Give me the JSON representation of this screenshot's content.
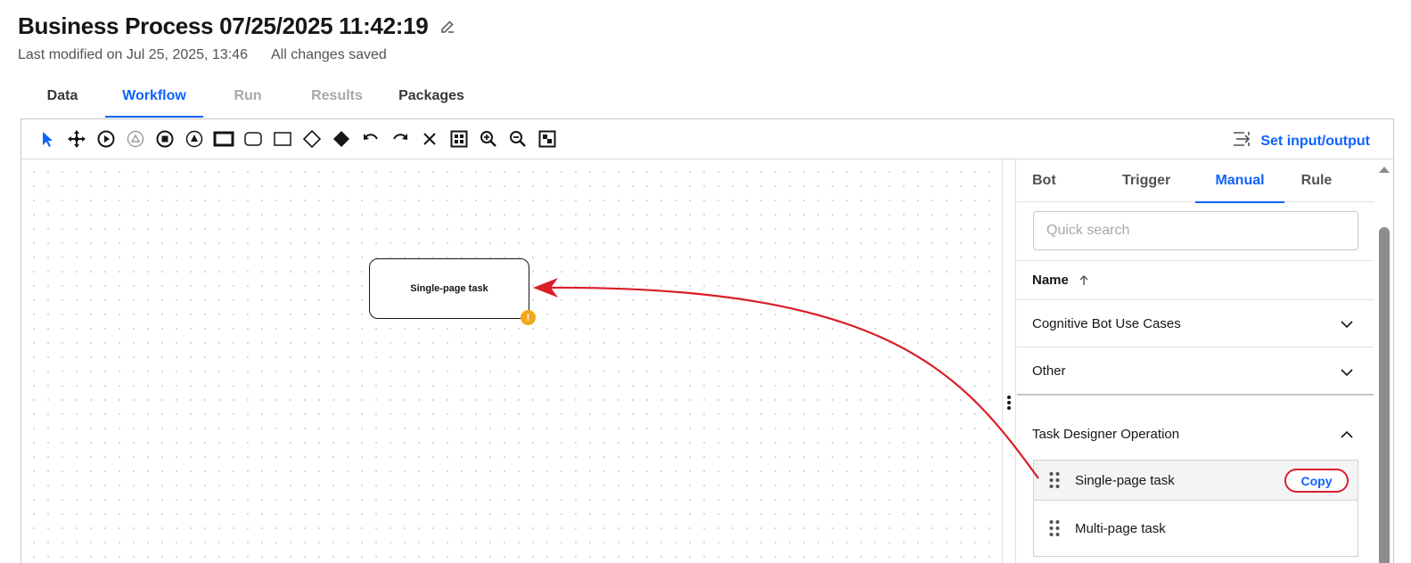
{
  "header": {
    "title": "Business Process 07/25/2025 11:42:19",
    "last_modified": "Last modified on Jul 25, 2025, 13:46",
    "save_status": "All changes saved"
  },
  "tabs": [
    {
      "label": "Data",
      "state": "default"
    },
    {
      "label": "Workflow",
      "state": "active"
    },
    {
      "label": "Run",
      "state": "disabled"
    },
    {
      "label": "Results",
      "state": "disabled"
    },
    {
      "label": "Packages",
      "state": "default"
    }
  ],
  "toolbar": {
    "tools": [
      "pointer-icon",
      "move-icon",
      "start-event-icon",
      "signal-event-icon",
      "end-event-icon",
      "escalation-event-icon",
      "subprocess-icon",
      "task-icon",
      "rectangle-icon",
      "gateway-icon",
      "filled-gateway-icon",
      "undo-icon",
      "redo-icon",
      "delete-icon",
      "fit-to-screen-icon",
      "zoom-in-icon",
      "zoom-out-icon",
      "minimap-icon"
    ],
    "set_io_label": "Set input/output"
  },
  "canvas": {
    "node_label": "Single-page task",
    "warning_symbol": "!"
  },
  "panel": {
    "tabs": [
      {
        "label": "Bot",
        "state": "default"
      },
      {
        "label": "Trigger",
        "state": "default"
      },
      {
        "label": "Manual",
        "state": "active"
      },
      {
        "label": "Rule",
        "state": "default"
      }
    ],
    "search_placeholder": "Quick search",
    "name_header": "Name",
    "groups": [
      {
        "label": "Cognitive Bot Use Cases",
        "expanded": false
      },
      {
        "label": "Other",
        "expanded": false
      },
      {
        "label": "Task Designer Operation",
        "expanded": true
      }
    ],
    "items": [
      {
        "label": "Single-page task",
        "action": "Copy"
      },
      {
        "label": "Multi-page task"
      }
    ]
  },
  "colors": {
    "accent": "#0f62fe",
    "annotation": "#da1e28",
    "warning": "#f1a81b"
  }
}
